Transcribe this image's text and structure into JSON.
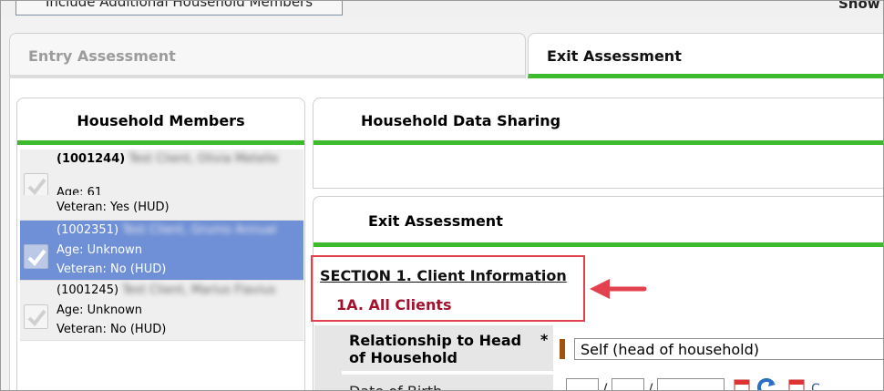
{
  "toolbar": {
    "include_button": "Include Additional Household Members",
    "show_label": "Show"
  },
  "tabs": [
    {
      "label": "Entry Assessment",
      "active": false
    },
    {
      "label": "Exit Assessment",
      "active": true
    }
  ],
  "household": {
    "title": "Household Members",
    "members": [
      {
        "id": "(1001244)",
        "name": "Test Client, Olivia Metello",
        "age": "Age: 61",
        "veteran": "Veteran: Yes (HUD)",
        "selected": false
      },
      {
        "id": "(1002351)",
        "name": "Test Client, Grumo Annual",
        "age": "Age: Unknown",
        "veteran": "Veteran: No (HUD)",
        "selected": true
      },
      {
        "id": "(1001245)",
        "name": "Test Client, Marius Flavius",
        "age": "Age: Unknown",
        "veteran": "Veteran: No (HUD)",
        "selected": false
      }
    ]
  },
  "sharing": {
    "title": "Household Data Sharing"
  },
  "exit": {
    "title": "Exit Assessment",
    "section_title": "SECTION 1. Client Information",
    "subsection": "1A. All Clients",
    "field_relationship_line1": "Relationship to Head",
    "field_relationship_line2": "of Household",
    "required_marker": "*",
    "relationship_value": "Self (head of household)",
    "field_dob": "Date of Birth",
    "dob_separator": "/",
    "calendar_link_partial": "C"
  },
  "colors": {
    "accent_green": "#3dba2d",
    "selected_row": "#6f8fd6",
    "section_red": "#a4122e",
    "highlight_red": "#e4414f"
  },
  "icons": [
    "checkbox-check-icon",
    "calendar-icon",
    "refresh-icon",
    "arrow-left-icon"
  ]
}
